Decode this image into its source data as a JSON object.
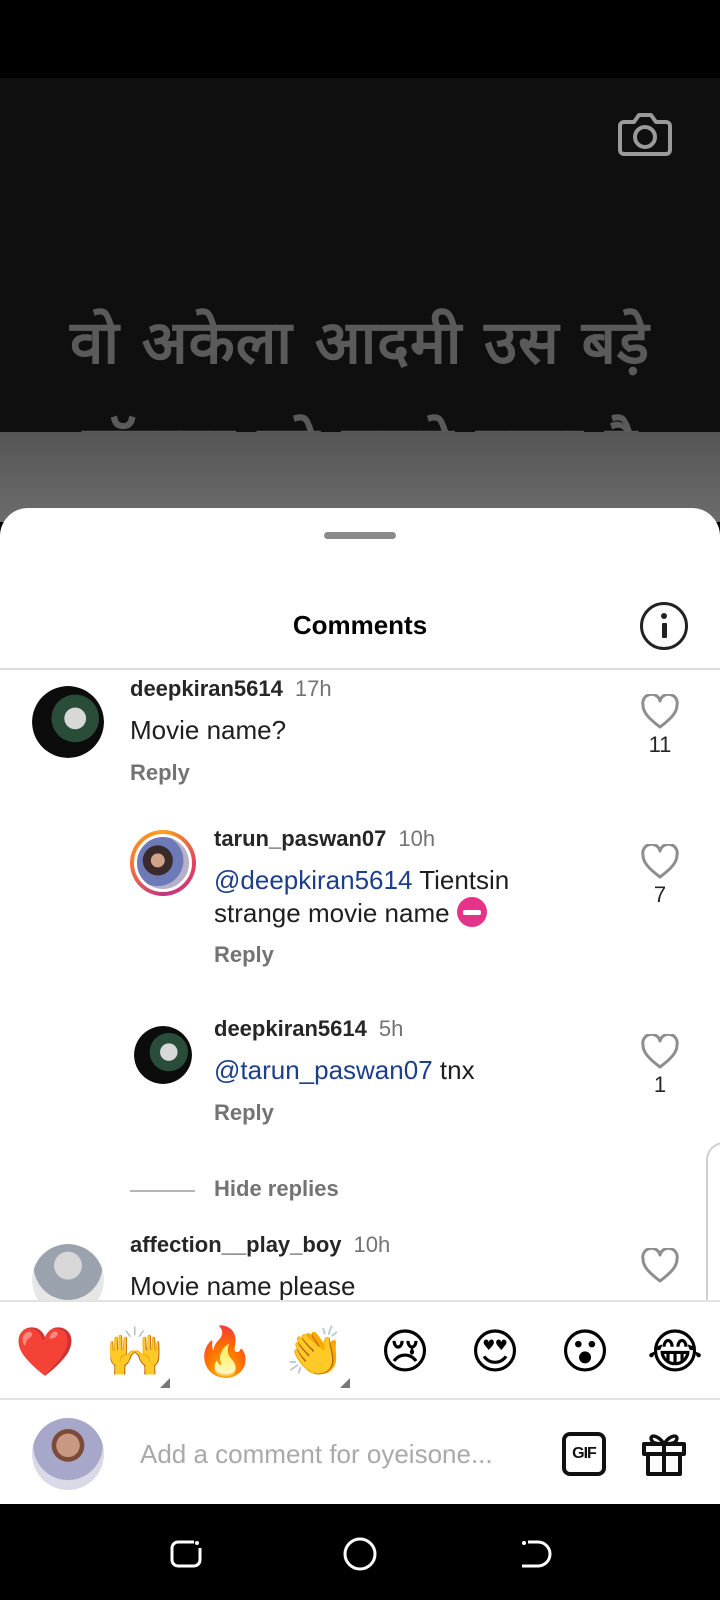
{
  "video": {
    "caption_line1": "वो अकेला आदमी उस बड़े",
    "caption_line2": "मॉन्स्टर को मारने वाला है"
  },
  "sheet": {
    "title": "Comments"
  },
  "comments": [
    {
      "username": "deepkiran5614",
      "time": "17h",
      "text": "Movie name?",
      "reply_label": "Reply",
      "likes": "11"
    },
    {
      "username": "tarun_paswan07",
      "time": "10h",
      "mention": "@deepkiran5614",
      "text": " Tientsin strange movie name ",
      "reply_label": "Reply",
      "likes": "7"
    },
    {
      "username": "deepkiran5614",
      "time": "5h",
      "mention": "@tarun_paswan07",
      "text": " tnx",
      "reply_label": "Reply",
      "likes": "1"
    },
    {
      "username": "affection__play_boy",
      "time": "10h",
      "text": "Movie name please"
    }
  ],
  "hide_replies_label": "Hide replies",
  "emoji_bar": [
    "❤️",
    "🙌",
    "🔥",
    "👏",
    "😢",
    "😍",
    "😮",
    "😂"
  ],
  "composer": {
    "placeholder": "Add a comment for oyeisone...",
    "gif_label": "GIF"
  },
  "icons": {
    "camera": "camera-icon",
    "info": "info-icon",
    "like": "heart-outline-icon",
    "gift": "gift-icon",
    "nav_recents": "recents-icon",
    "nav_home": "home-circle-icon",
    "nav_back": "back-icon"
  }
}
